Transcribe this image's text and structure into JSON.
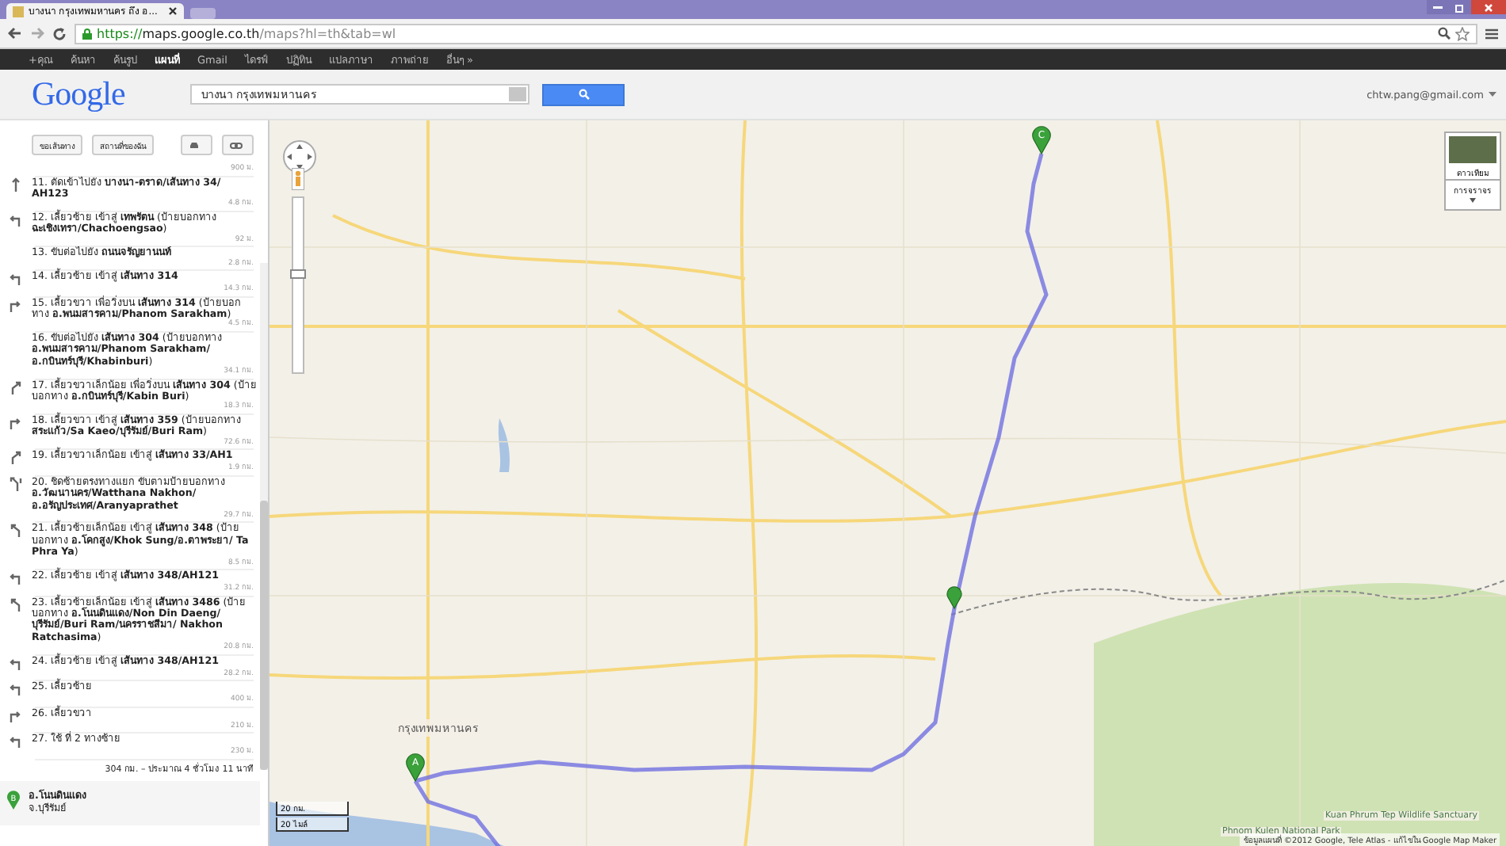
{
  "browser": {
    "tabs": [
      {
        "title": "บางนา กรุงเทพมหานคร ถึง อ...",
        "selected": true
      }
    ],
    "url": {
      "scheme": "https://",
      "host": "maps.google.co.th",
      "path": "/maps?hl=th&tab=wl"
    }
  },
  "gbar": {
    "links": [
      {
        "label": "+คุณ",
        "selected": false
      },
      {
        "label": "ค้นหา",
        "selected": false
      },
      {
        "label": "ค้นรูป",
        "selected": false
      },
      {
        "label": "แผนที่",
        "selected": true
      },
      {
        "label": "Gmail",
        "selected": false
      },
      {
        "label": "ไดรฟ์",
        "selected": false
      },
      {
        "label": "ปฏิทิน",
        "selected": false
      },
      {
        "label": "แปลภาษา",
        "selected": false
      },
      {
        "label": "ภาพถ่าย",
        "selected": false
      },
      {
        "label": "อื่นๆ »",
        "selected": false
      }
    ]
  },
  "header": {
    "logo": "Google",
    "search": {
      "value": "บางนา กรุงเทพมหานคร"
    },
    "account": "chtw.pang@gmail.com"
  },
  "sidebar": {
    "buttons": [
      "ขอเส้นทาง",
      "สถานที่ของฉัน"
    ],
    "first_distance": "900 ม.",
    "steps": [
      {
        "text": "11. ตัดเข้าไปยัง **บางนา-ตราด/เส้นทาง 34/ AH123**",
        "kind": "straight",
        "distance": "4.8 กม."
      },
      {
        "text": "12. เลี้ยวซ้าย เข้าสู่ **เทพรัตน** (ป้ายบอกทาง **ฉะเชิงเทรา/Chachoengsao**)",
        "kind": "left",
        "distance": "92 ม."
      },
      {
        "text": "13. ขับต่อไปยัง **ถนนจรัญยานนท์**",
        "kind": "none",
        "distance": "2.8 กม."
      },
      {
        "text": "14. เลี้ยวซ้าย เข้าสู่ **เส้นทาง 314**",
        "kind": "left",
        "distance": "14.3 กม."
      },
      {
        "text": "15. เลี้ยวขวา เพื่อวิ่งบน **เส้นทาง 314** (ป้ายบอกทาง **อ.พนมสารคาม/Phanom Sarakham**)",
        "kind": "right",
        "distance": "4.5 กม."
      },
      {
        "text": "16. ขับต่อไปยัง **เส้นทาง 304** (ป้ายบอกทาง **อ.พนมสารคาม/Phanom Sarakham/ อ.กบินทร์บุรี/Khabinburi**)",
        "kind": "none",
        "distance": "34.1 กม."
      },
      {
        "text": "17. เลี้ยวขวาเล็กน้อย เพื่อวิ่งบน **เส้นทาง 304** (ป้ายบอกทาง **อ.กบินทร์บุรี/Kabin Buri**)",
        "kind": "slight-right",
        "distance": "18.3 กม."
      },
      {
        "text": "18. เลี้ยวขวา เข้าสู่ **เส้นทาง 359** (ป้ายบอกทาง **สระแก้ว/Sa Kaeo/บุรีรัมย์/Buri Ram**)",
        "kind": "right",
        "distance": "72.6 กม."
      },
      {
        "text": "19. เลี้ยวขวาเล็กน้อย เข้าสู่ **เส้นทาง 33/AH1**",
        "kind": "slight-right",
        "distance": "1.9 กม."
      },
      {
        "text": "20. ชิดซ้ายตรงทางแยก ขับตามป้ายบอกทาง **อ.วัฒนานคร/Watthana Nakhon/ อ.อรัญประเทศ/Aranyaprathet**",
        "kind": "keep-left",
        "distance": "29.7 กม."
      },
      {
        "text": "21. เลี้ยวซ้ายเล็กน้อย เข้าสู่ **เส้นทาง 348** (ป้ายบอกทาง **อ.โคกสูง/Khok Sung/อ.ตาพระยา/ Ta Phra Ya**)",
        "kind": "slight-left",
        "distance": "8.5 กม."
      },
      {
        "text": "22. เลี้ยวซ้าย เข้าสู่ **เส้นทาง 348/AH121**",
        "kind": "left",
        "distance": "31.2 กม."
      },
      {
        "text": "23. เลี้ยวซ้ายเล็กน้อย เข้าสู่ **เส้นทาง 3486** (ป้ายบอกทาง **อ.โนนดินแดง/Non Din Daeng/บุรีรัมย์/Buri Ram/นครราชสีมา/ Nakhon Ratchasima**)",
        "kind": "slight-left",
        "distance": "20.8 กม."
      },
      {
        "text": "24. เลี้ยวซ้าย เข้าสู่ **เส้นทาง 348/AH121**",
        "kind": "left",
        "distance": "28.2 กม."
      },
      {
        "text": "25. เลี้ยวซ้าย",
        "kind": "left",
        "distance": "400 ม."
      },
      {
        "text": "26. เลี้ยวขวา",
        "kind": "right",
        "distance": "210 ม."
      },
      {
        "text": "27. ใช้ ที่ 2 ทางซ้าย",
        "kind": "left",
        "distance": "230 ม."
      }
    ],
    "summary": "304 กม. – ประมาณ 4 ชั่วโมง 11 นาที",
    "destination": {
      "letter": "B",
      "lines": [
        "อ.โนนดินแดง",
        "จ.บุรีรัมย์"
      ]
    }
  },
  "map": {
    "markers": [
      {
        "letter": "A"
      },
      {
        "letter": "C"
      }
    ],
    "labels": [
      "กรุงเทพมหานคร",
      "Kuan Phrum Tep Wildlife Sanctuary",
      "Phnom Kulen National Park"
    ],
    "zoom": {
      "level": 0.55
    },
    "satellite": "ดาวเทียม",
    "traffic": "การจราจร",
    "scale": [
      "20 กม.",
      "20 ไมล์"
    ],
    "attribution": "ข้อมูลแผนที่ ©2012 Google, Tele Atlas - แก้ไขใน Google Map Maker"
  }
}
